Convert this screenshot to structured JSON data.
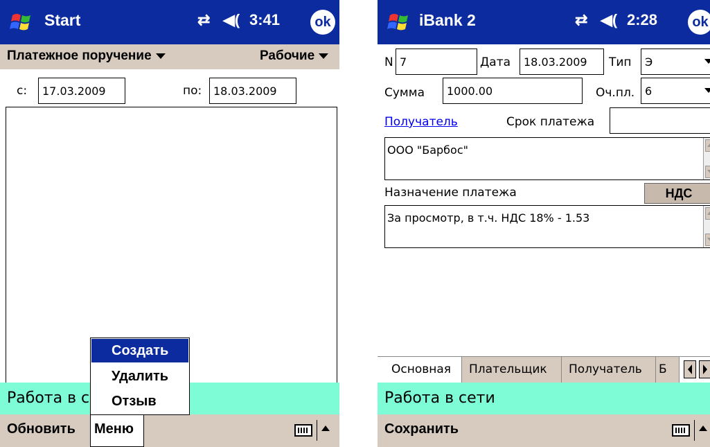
{
  "screen1": {
    "title": "Start",
    "time": "3:41",
    "ok": "ok",
    "doc_type": "Платежное поручение",
    "doc_filter": "Рабочие",
    "from_label": "с:",
    "from_value": "17.03.2009",
    "to_label": "по:",
    "to_value": "18.03.2009",
    "status": "Работа в с",
    "bottom_left": "Обновить",
    "bottom_menu": "Меню",
    "popup_menu": [
      "Создать",
      "Удалить",
      "Отзыв"
    ]
  },
  "screen2": {
    "title": "iBank 2",
    "time": "2:28",
    "ok": "ok",
    "n_label": "N",
    "n_value": "7",
    "date_label": "Дата",
    "date_value": "18.03.2009",
    "type_label": "Тип",
    "type_value": "Э",
    "sum_label": "Сумма",
    "sum_value": "1000.00",
    "priority_label": "Оч.пл.",
    "priority_value": "6",
    "recipient_link": "Получатель",
    "deadline_label": "Срок платежа",
    "recipient_text": "ООО \"Барбос\"",
    "purpose_label": "Назначение платежа",
    "nds_button": "НДС",
    "purpose_text": "За просмотр,  в т.ч. НДС 18% - 1.53",
    "tabs": [
      "Основная",
      "Плательщик",
      "Получатель",
      "Б"
    ],
    "status": "Работа в сети",
    "bottom_left": "Сохранить"
  }
}
